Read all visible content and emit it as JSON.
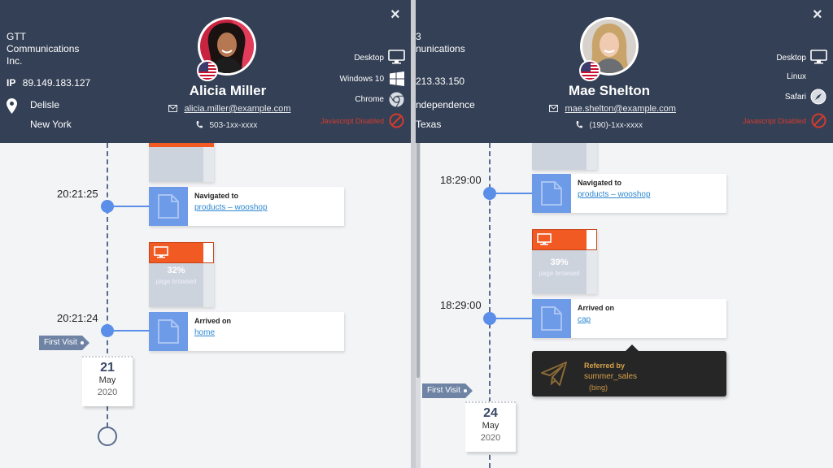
{
  "left": {
    "header": {
      "close_icon": "×",
      "company": [
        "GTT",
        "Communications",
        "Inc."
      ],
      "ip_label": "IP",
      "ip_value": "89.149.183.127",
      "city": "Delisle",
      "region": "New York",
      "name": "Alicia Miller",
      "email": "alicia.miller@example.com",
      "phone": "503-1xx-xxxx",
      "device": "Desktop",
      "os": "Windows 10",
      "browser": "Chrome",
      "js_status": "Javascript Disabled"
    },
    "timeline": {
      "events": [
        {
          "time": "20:21:25",
          "title": "Navigated to",
          "link": "products – wooshop"
        },
        {
          "time": "20:21:24",
          "title": "Arrived on",
          "link": "home"
        }
      ],
      "browsed": {
        "percent": "32%",
        "label": "page browsed"
      },
      "first_visit": "First Visit",
      "date": {
        "day": "21",
        "month": "May",
        "year": "2020"
      }
    }
  },
  "right": {
    "header": {
      "close_icon": "×",
      "company": [
        "3",
        "nunications"
      ],
      "ip_value": "213.33.150",
      "city": "ndependence",
      "region": "Texas",
      "name": "Mae Shelton",
      "email": "mae.shelton@example.com",
      "phone": "(190)-1xx-xxxx",
      "device": "Desktop",
      "os": "Linux",
      "browser": "Safari",
      "js_status": "Javascript Disabled"
    },
    "timeline": {
      "events": [
        {
          "time": "18:29:00",
          "title": "Navigated to",
          "link": "products – wooshop"
        },
        {
          "time": "18:29:00",
          "title": "Arrived on",
          "link": "cap"
        }
      ],
      "browsed": {
        "percent": "39%",
        "label": "page browsed"
      },
      "referral": {
        "label": "Referred by",
        "source": "summer_sales",
        "medium": "(bing)"
      },
      "first_visit": "First Visit",
      "date": {
        "day": "24",
        "month": "May",
        "year": "2020"
      }
    }
  },
  "colors": {
    "header_bg": "#344055",
    "accent_blue": "#5b8ee8",
    "browse_orange": "#f15a22",
    "warning_red": "#d23b2f",
    "referral_gold": "#d6a24a"
  }
}
